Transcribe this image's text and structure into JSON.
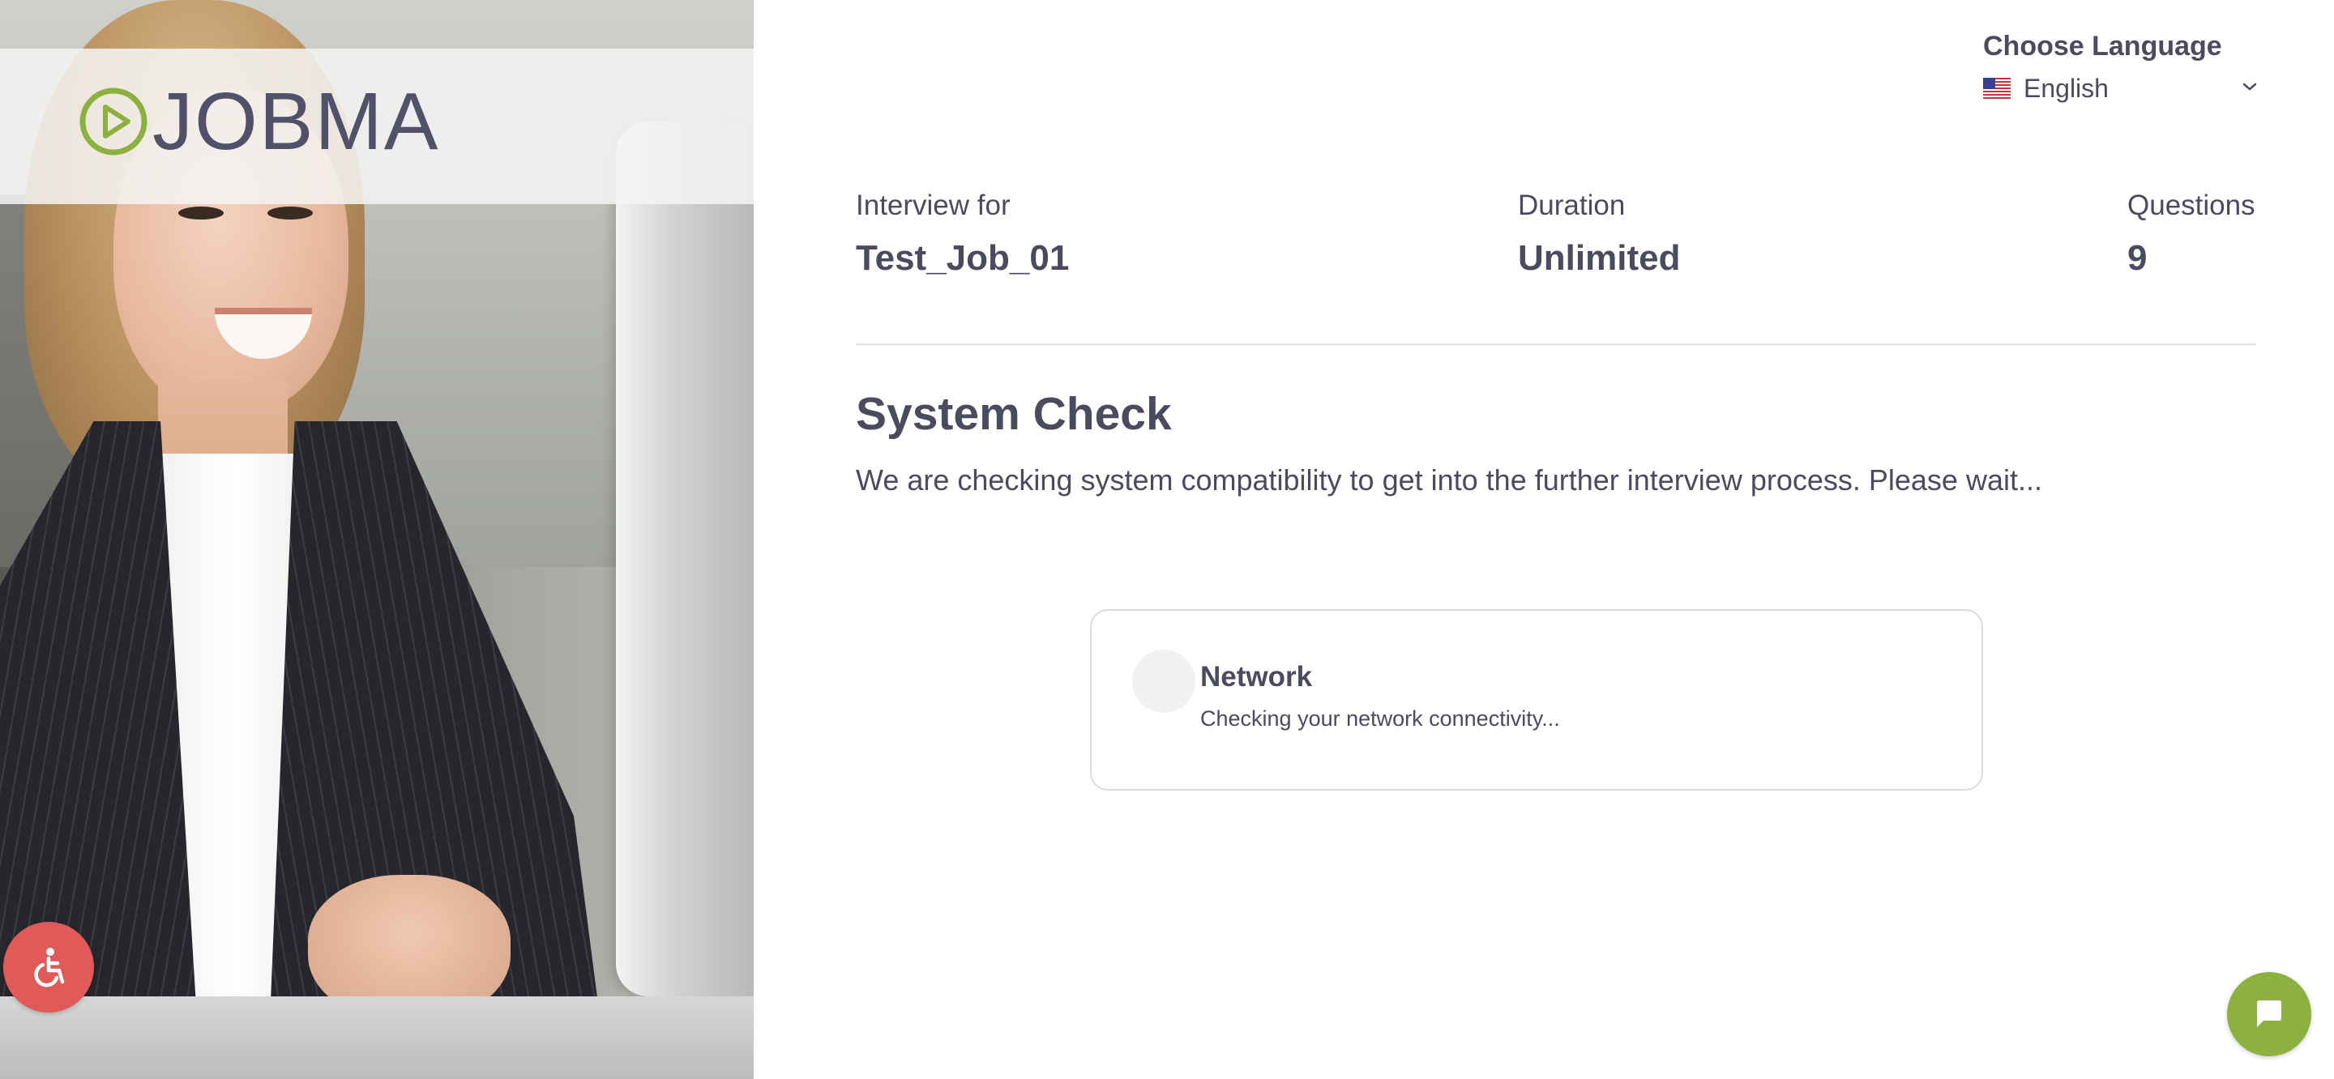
{
  "brand": {
    "logo_text": "JOBMA",
    "logo_accent_color": "#8cb13f",
    "logo_text_color": "#51526a"
  },
  "language": {
    "title": "Choose Language",
    "selected": "English",
    "flag_icon": "us-flag-icon"
  },
  "interview": {
    "job_label": "Interview for",
    "job_value": "Test_Job_01",
    "duration_label": "Duration",
    "duration_value": "Unlimited",
    "questions_label": "Questions",
    "questions_value": "9"
  },
  "system_check": {
    "title": "System Check",
    "description": "We are checking system compatibility to get into the further interview process. Please wait...",
    "items": [
      {
        "title": "Network",
        "status": "Checking your network connectivity..."
      }
    ]
  },
  "widgets": {
    "accessibility_icon": "accessibility-icon",
    "accessibility_color": "#df5a59",
    "chat_icon": "chat-icon",
    "chat_color": "#8cb13f"
  }
}
